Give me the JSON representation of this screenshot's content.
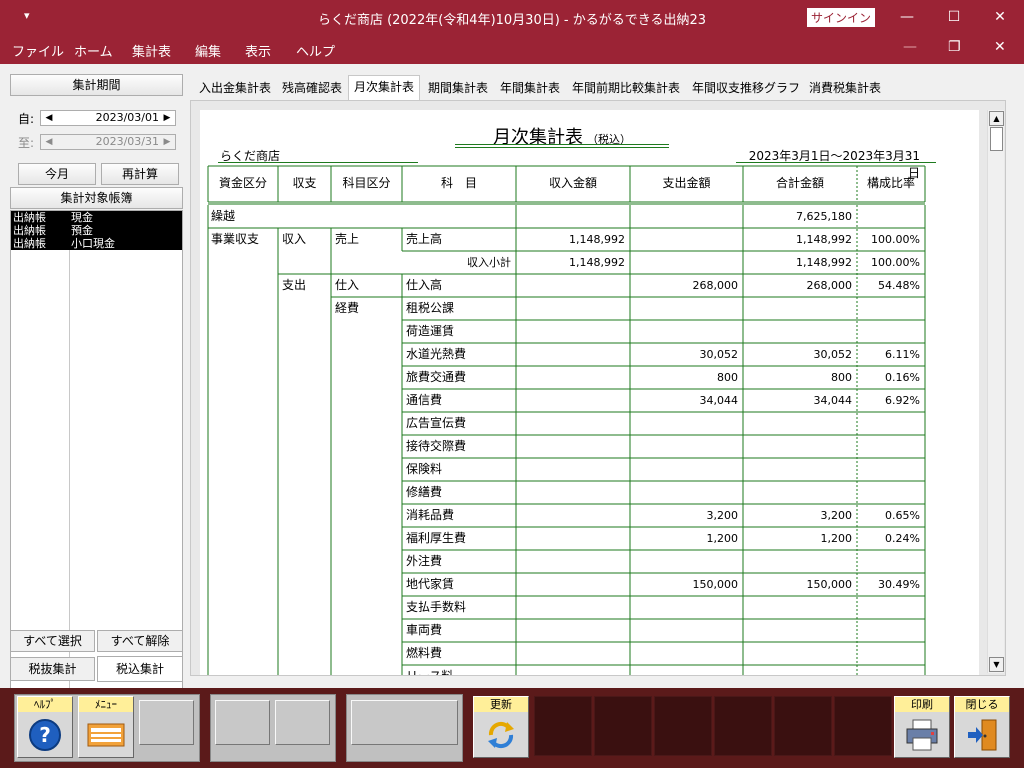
{
  "titlebar": {
    "title": "らくだ商店 (2022年(令和4年)10月30日)  -  かるがるできる出納23",
    "sysmenu_glyph": "▾",
    "signin_label": "サインイン",
    "minimize_glyph": "—",
    "maximize_glyph": "☐",
    "close_glyph": "✕"
  },
  "menubar": {
    "items": [
      "ファイル",
      "ホーム",
      "集計表",
      "編集",
      "表示",
      "ヘルプ"
    ],
    "mdi_minimize_glyph": "—",
    "mdi_restore_glyph": "❐",
    "mdi_close_glyph": "✕"
  },
  "left_panel": {
    "period_button": "集計期間",
    "from_label": "自:",
    "from_date": "2023/03/01",
    "to_label": "至:",
    "to_date": "2023/03/31",
    "this_month_button": "今月",
    "recalc_button": "再計算",
    "target_books_button": "集計対象帳簿",
    "books": [
      {
        "type": "出納帳",
        "name": "現金"
      },
      {
        "type": "出納帳",
        "name": "預金"
      },
      {
        "type": "出納帳",
        "name": "小口現金"
      }
    ],
    "select_all_button": "すべて選択",
    "deselect_all_button": "すべて解除",
    "tax_excluded_tab": "税抜集計",
    "tax_included_tab": "税込集計"
  },
  "tabs": [
    "入出金集計表",
    "残高確認表",
    "月次集計表",
    "期間集計表",
    "年間集計表",
    "年間前期比較集計表",
    "年間収支推移グラフ",
    "消費税集計表"
  ],
  "active_tab_index": 2,
  "report": {
    "title": "月次集計表",
    "title_suffix": "（税込）",
    "store_name": "らくだ商店",
    "period": "2023年3月1日～2023年3月31日",
    "headers": [
      "資金区分",
      "収支",
      "科目区分",
      "科　目",
      "収入金額",
      "支出金額",
      "合計金額",
      "構成比率"
    ],
    "carryover": {
      "label": "繰越",
      "total": "7,625,180"
    },
    "fund_category": "事業収支",
    "income_label": "収入",
    "expense_label": "支出",
    "income_rows": [
      {
        "category": "売上",
        "account": "売上高",
        "income": "1,148,992",
        "expense": "",
        "total": "1,148,992",
        "ratio": "100.00%"
      }
    ],
    "income_subtotal": {
      "label": "収入小計",
      "income": "1,148,992",
      "total": "1,148,992",
      "ratio": "100.00%"
    },
    "expense_rows": [
      {
        "category": "仕入",
        "account": "仕入高",
        "income": "",
        "expense": "268,000",
        "total": "268,000",
        "ratio": "54.48%"
      },
      {
        "category": "経費",
        "account": "租税公課",
        "income": "",
        "expense": "",
        "total": "",
        "ratio": ""
      },
      {
        "category": "",
        "account": "荷造運賃",
        "income": "",
        "expense": "",
        "total": "",
        "ratio": ""
      },
      {
        "category": "",
        "account": "水道光熱費",
        "income": "",
        "expense": "30,052",
        "total": "30,052",
        "ratio": "6.11%"
      },
      {
        "category": "",
        "account": "旅費交通費",
        "income": "",
        "expense": "800",
        "total": "800",
        "ratio": "0.16%"
      },
      {
        "category": "",
        "account": "通信費",
        "income": "",
        "expense": "34,044",
        "total": "34,044",
        "ratio": "6.92%"
      },
      {
        "category": "",
        "account": "広告宣伝費",
        "income": "",
        "expense": "",
        "total": "",
        "ratio": ""
      },
      {
        "category": "",
        "account": "接待交際費",
        "income": "",
        "expense": "",
        "total": "",
        "ratio": ""
      },
      {
        "category": "",
        "account": "保険料",
        "income": "",
        "expense": "",
        "total": "",
        "ratio": ""
      },
      {
        "category": "",
        "account": "修繕費",
        "income": "",
        "expense": "",
        "total": "",
        "ratio": ""
      },
      {
        "category": "",
        "account": "消耗品費",
        "income": "",
        "expense": "3,200",
        "total": "3,200",
        "ratio": "0.65%"
      },
      {
        "category": "",
        "account": "福利厚生費",
        "income": "",
        "expense": "1,200",
        "total": "1,200",
        "ratio": "0.24%"
      },
      {
        "category": "",
        "account": "外注費",
        "income": "",
        "expense": "",
        "total": "",
        "ratio": ""
      },
      {
        "category": "",
        "account": "地代家賃",
        "income": "",
        "expense": "150,000",
        "total": "150,000",
        "ratio": "30.49%"
      },
      {
        "category": "",
        "account": "支払手数料",
        "income": "",
        "expense": "",
        "total": "",
        "ratio": ""
      },
      {
        "category": "",
        "account": "車両費",
        "income": "",
        "expense": "",
        "total": "",
        "ratio": ""
      },
      {
        "category": "",
        "account": "燃料費",
        "income": "",
        "expense": "",
        "total": "",
        "ratio": ""
      },
      {
        "category": "",
        "account": "リース料",
        "income": "",
        "expense": "",
        "total": "",
        "ratio": ""
      }
    ]
  },
  "toolbar": {
    "help_label": "ﾍﾙﾌﾟ",
    "menu_label": "ﾒﾆｭｰ",
    "refresh_label": "更新",
    "print_label": "印刷",
    "close_label": "閉じる"
  },
  "colors": {
    "titlebar": "#9b2335",
    "toolbar": "#5b1a1a",
    "table_lines": "#1e7a1e",
    "button_label_bg": "#ffef99"
  }
}
